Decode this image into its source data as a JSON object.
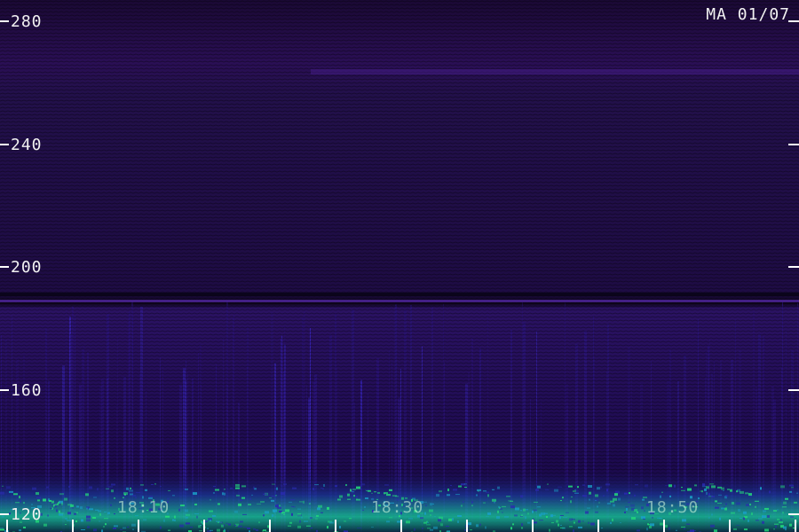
{
  "session_label": "MA 01/07",
  "y_axis": {
    "ticks": [
      {
        "value": 280,
        "label": "280"
      },
      {
        "value": 240,
        "label": "240"
      },
      {
        "value": 200,
        "label": "200"
      },
      {
        "value": 160,
        "label": "160"
      },
      {
        "value": 120,
        "label": "120"
      }
    ],
    "range": [
      120,
      290
    ]
  },
  "time_axis": {
    "labels": [
      "18:10",
      "18:30",
      "18:50"
    ]
  },
  "colors": {
    "background": "#16082a",
    "band_purple": "#3b1670",
    "noise_low": "#1f0b5c",
    "noise_high": "#18d8a0",
    "label_text": "#f2f2f2",
    "tick_marks": "#ffffff"
  }
}
